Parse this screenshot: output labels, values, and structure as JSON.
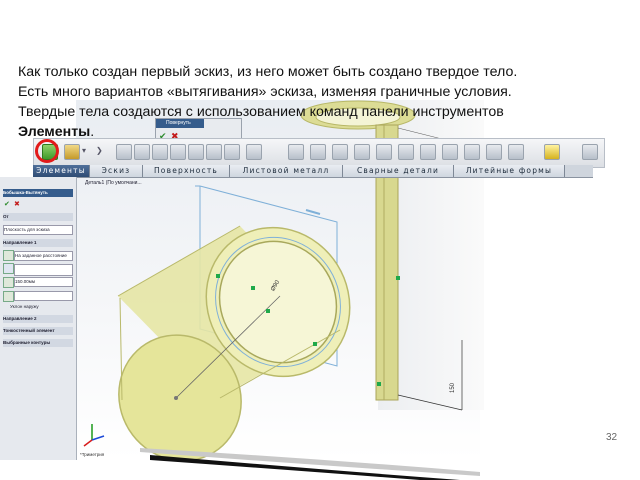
{
  "slide": {
    "line1": "Как только создан первый эскиз, из него может быть создано твердое тело.",
    "line2": " Есть много вариантов «вытягивания» эскиза, изменяя граничные условия.",
    "line3": "Твердые тела создаются с использованием команд панели инструментов",
    "line4_bold": "Элементы",
    "line4_tail": ".",
    "page_number": "32"
  },
  "command_manager": {
    "tabs": [
      {
        "label": "Элементы",
        "active": true
      },
      {
        "label": "Эскиз"
      },
      {
        "label": "Поверхность"
      },
      {
        "label": "Листовой металл"
      },
      {
        "label": "Сварные детали"
      },
      {
        "label": "Литейные формы"
      }
    ],
    "highlighted_tool": "extruded-boss-base-icon"
  },
  "property_manager": {
    "title": "Бобышка-Вытянуть",
    "from_label": "От",
    "from_value": "Плоскость для эскиза",
    "direction1_label": "Направление 1",
    "end_condition": "На заданное расстояние",
    "depth_value": "150.00мм",
    "draft_label": "Уклон наружу",
    "direction2_label": "Направление 2",
    "thin_feature_label": "Тонкостенный элемент",
    "selected_contours_label": "Выбранные контуры"
  },
  "mini_panel": {
    "title": "Повернуть"
  },
  "feature_tree": {
    "item": "Деталь1 (По умолчани..."
  },
  "viewport": {
    "dimension_diameter": "Ø90",
    "dimension_length": "150",
    "view_label": "*Триметрия"
  },
  "colors": {
    "solid_fill": "#e5e59a",
    "solid_edge": "#b9b96a",
    "sketch_line": "#7fb0d8",
    "highlight": "#e21a1a",
    "tab_active": "#2f4c74"
  }
}
